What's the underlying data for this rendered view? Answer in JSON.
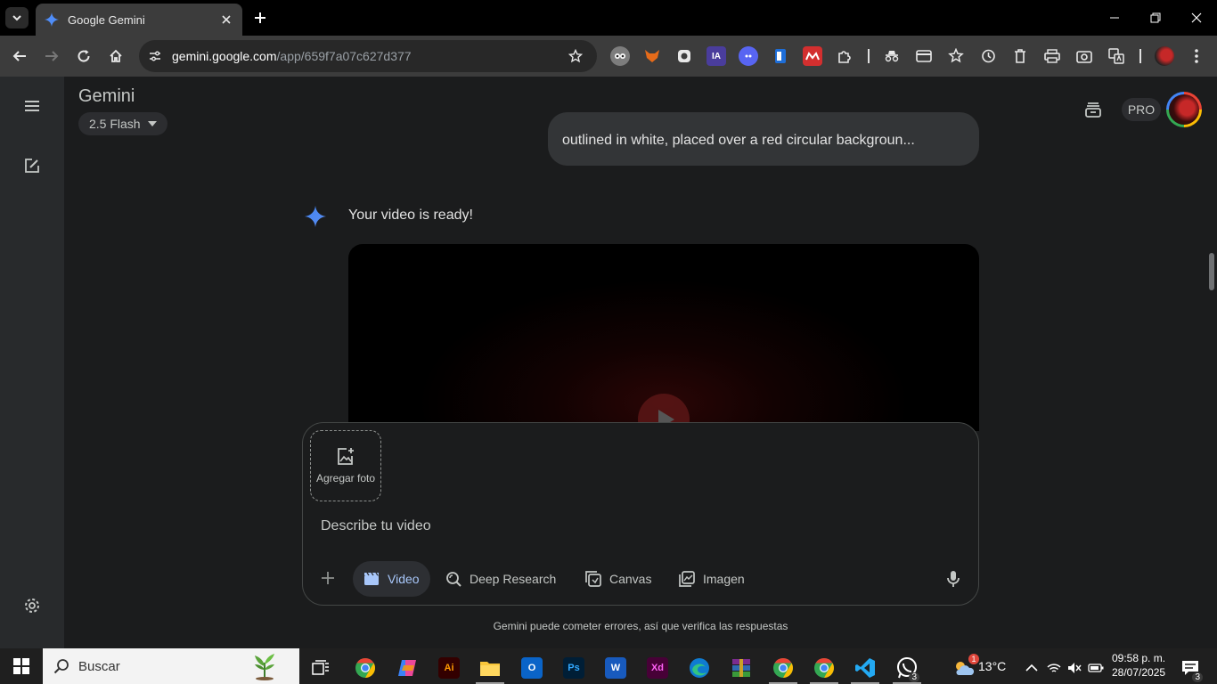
{
  "browser": {
    "tab_title": "Google Gemini",
    "url_host": "gemini.google.com",
    "url_path": "/app/659f7a07c627d377",
    "extensions": [
      {
        "name": "ext-owl",
        "color": "#8a8a8a",
        "text": ""
      },
      {
        "name": "ext-fox",
        "color": "#e66b1a",
        "text": ""
      },
      {
        "name": "ext-record",
        "color": "#444",
        "text": ""
      },
      {
        "name": "ext-ia",
        "color": "#4a3d9c",
        "text": "IA"
      },
      {
        "name": "ext-ghost",
        "color": "#5865f2",
        "text": ""
      },
      {
        "name": "ext-doc",
        "color": "#1e6ed8",
        "text": ""
      },
      {
        "name": "ext-mendeley",
        "color": "#d32f2f",
        "text": ""
      },
      {
        "name": "ext-puzzle",
        "color": "transparent",
        "text": ""
      }
    ]
  },
  "gemini": {
    "app_title": "Gemini",
    "model": "2.5 Flash",
    "pro_label": "PRO",
    "avatar_text": "",
    "user_message": "outlined in white, placed over a red circular backgroun...",
    "response_text": "Your video is ready!",
    "attach_label": "Agregar foto",
    "prompt_placeholder": "Describe tu video",
    "tools": {
      "video": "Video",
      "deep_research": "Deep Research",
      "canvas": "Canvas",
      "imagen": "Imagen"
    },
    "disclaimer": "Gemini puede cometer errores, así que verifica las respuestas",
    "accent": "#a8c7fa"
  },
  "taskbar": {
    "search_label": "Buscar",
    "weather": "13°C",
    "time": "09:58 p. m.",
    "date": "28/07/2025",
    "notification_count": "3",
    "whatsapp_count": "3",
    "weather_alert": "1"
  }
}
